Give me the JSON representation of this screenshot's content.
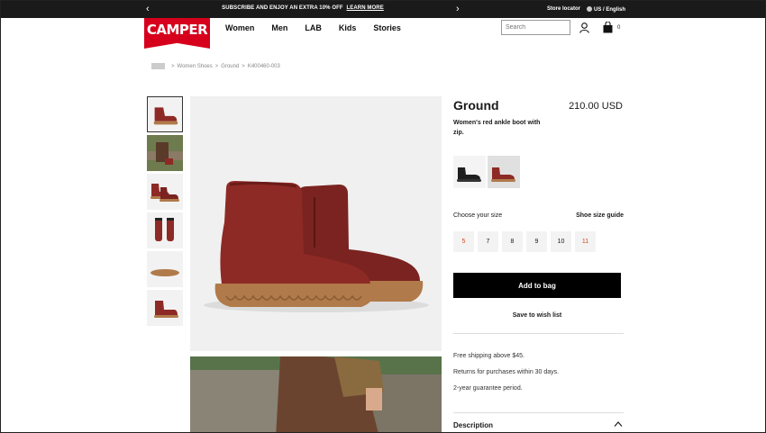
{
  "promo": {
    "prev_arrow": "‹",
    "next_arrow": "›",
    "message": "SUBSCRIBE AND ENJOY AN EXTRA 10% OFF",
    "link": "LEARN MORE",
    "store_locator": "Store locator",
    "language": "US / English"
  },
  "header": {
    "logo": "CAMPER",
    "nav": [
      "Women",
      "Men",
      "LAB",
      "Kids",
      "Stories"
    ],
    "search_placeholder": "Search",
    "bag_count": "0"
  },
  "breadcrumb": {
    "items": [
      "Women Shoes",
      "Ground",
      "K400460-003"
    ],
    "separator": ">"
  },
  "product": {
    "title": "Ground",
    "price": "210.00 USD",
    "description": "Women's red ankle boot with zip.",
    "colors": [
      {
        "name": "black",
        "swatch": "#1f1f1f"
      },
      {
        "name": "red",
        "swatch": "#8e2a25"
      }
    ],
    "choose_size_label": "Choose your size",
    "size_guide_label": "Shoe size guide",
    "sizes": [
      {
        "label": "5",
        "low_stock": true
      },
      {
        "label": "7",
        "low_stock": false
      },
      {
        "label": "8",
        "low_stock": false
      },
      {
        "label": "9",
        "low_stock": false
      },
      {
        "label": "10",
        "low_stock": false
      },
      {
        "label": "11",
        "low_stock": true
      }
    ],
    "add_to_bag": "Add to bag",
    "wishlist": "Save to wish list",
    "info": [
      "Free shipping above $45.",
      "Returns for purchases within 30 days.",
      "2-year guarantee period."
    ],
    "description_heading": "Description"
  },
  "colors": {
    "brand_red": "#d6001c",
    "boot_red": "#8e2a25",
    "sole": "#b07a4a",
    "low_stock_text": "#d0481f"
  }
}
